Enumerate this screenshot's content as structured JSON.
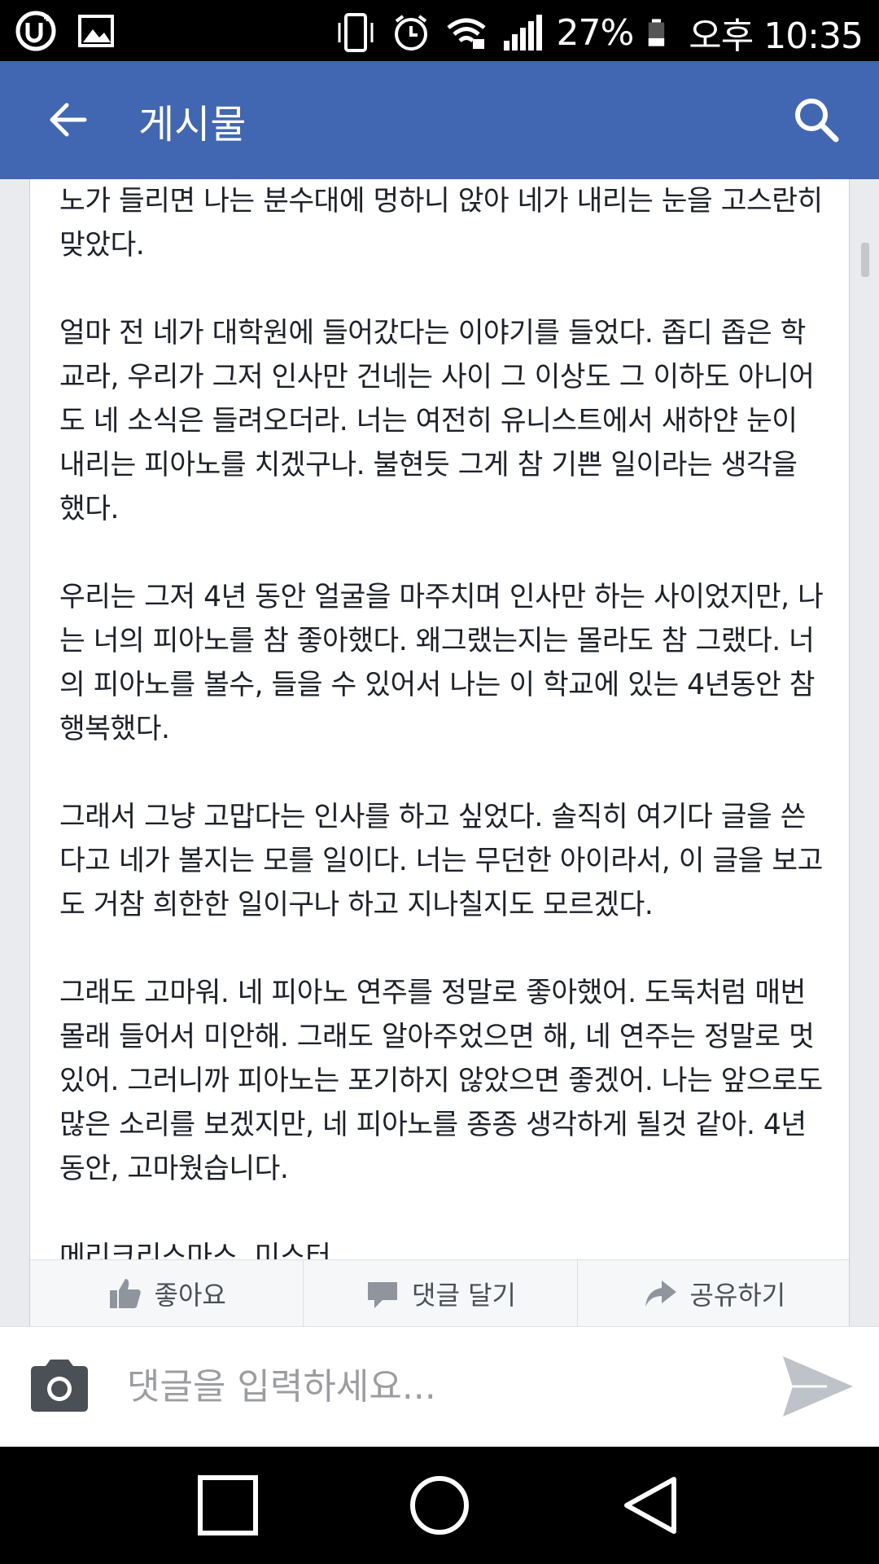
{
  "status_bar": {
    "battery": "27%",
    "time": "오후 10:35",
    "icons": [
      "u-plus-icon",
      "image-icon",
      "vibrate-icon",
      "alarm-icon",
      "wifi-icon",
      "signal-icon",
      "battery-icon"
    ]
  },
  "app_bar": {
    "title": "게시물",
    "back_icon": "arrow-left-icon",
    "search_icon": "search-icon",
    "background": "#4267b2"
  },
  "post": {
    "paragraphs": [
      "노가 들리면 나는 분수대에 멍하니 앉아 네가 내리는 눈을 고스란히 맞았다.",
      "얼마 전 네가 대학원에 들어갔다는 이야기를 들었다. 좁디 좁은 학교라, 우리가 그저 인사만 건네는 사이 그 이상도 그 이하도 아니어도 네 소식은 들려오더라. 너는 여전히 유니스트에서 새하얀 눈이 내리는 피아노를 치겠구나. 불현듯 그게 참 기쁜 일이라는 생각을 했다.",
      "우리는 그저 4년 동안 얼굴을 마주치며 인사만 하는 사이었지만, 나는 너의 피아노를 참 좋아했다. 왜그랬는지는 몰라도 참 그랬다. 너의 피아노를 볼수, 들을 수 있어서 나는 이 학교에 있는 4년동안 참 행복했다.",
      "그래서 그냥 고맙다는 인사를 하고 싶었다. 솔직히 여기다 글을 쓴다고 네가 볼지는 모를 일이다. 너는 무던한 아이라서, 이 글을 보고도 거참 희한한 일이구나 하고 지나칠지도 모르겠다.",
      "그래도 고마워. 네 피아노 연주를 정말로 좋아했어. 도둑처럼 매번 몰래 들어서 미안해. 그래도 알아주었으면 해, 네 연주는 정말로 멋있어. 그러니까 피아노는 포기하지 않았으면 좋겠어. 나는 앞으로도 많은 소리를 보겠지만, 네 피아노를 종종 생각하게 될것 같아. 4년동안, 고마웠습니다.",
      "메리크리스마스. 미스터."
    ]
  },
  "actions": {
    "like": "좋아요",
    "comment": "댓글 달기",
    "share": "공유하기"
  },
  "comment_bar": {
    "placeholder": "댓글을 입력하세요..."
  },
  "nav_bar": {
    "icons": [
      "recent-apps-icon",
      "home-icon",
      "back-icon"
    ]
  }
}
